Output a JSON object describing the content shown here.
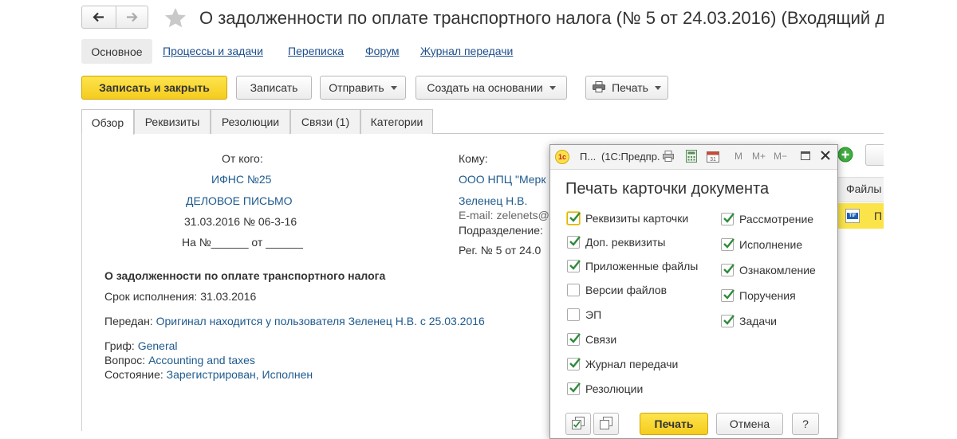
{
  "window": {
    "title": "О задолженности по оплате транспортного налога (№ 5 от 24.03.2016) (Входящий документ)"
  },
  "nav": {
    "main": "Основное",
    "links": [
      "Процессы и задачи",
      "Переписка",
      "Форум",
      "Журнал передачи"
    ]
  },
  "toolbar": {
    "save_close": "Записать и закрыть",
    "save": "Записать",
    "send": "Отправить",
    "create_based": "Создать на основании",
    "print": "Печать"
  },
  "tabs": [
    "Обзор",
    "Реквизиты",
    "Резолюции",
    "Связи (1)",
    "Категории"
  ],
  "doc": {
    "from_label": "От кого:",
    "from_org": "ИФНС №25",
    "doc_kind": "ДЕЛОВОЕ ПИСЬМО",
    "date_number": "31.03.2016 № 06-3-16",
    "ref_line": "На №______ от ______",
    "to_label": "Кому:",
    "to_org": "ООО НПЦ \"Мерк",
    "to_person": "Зеленец Н.В.",
    "email": "E-mail: zelenets@",
    "division_label": "Подразделение:",
    "reg": "Рег. № 5 от 24.0",
    "subject": "О задолженности по оплате транспортного налога",
    "deadline_label": "Срок исполнения:",
    "deadline_value": "31.03.2016",
    "handed_label": "Передан:",
    "handed_value": "Оригинал находится у пользователя Зеленец Н.В. с 25.03.2016",
    "grif_label": "Гриф:",
    "grif_value": "General",
    "question_label": "Вопрос:",
    "question_value": "Accounting and taxes",
    "state_label": "Состояние:",
    "state_value": "Зарегистрирован, Исполнен"
  },
  "right_panel": {
    "files_label": "Файлы",
    "file_item": "П"
  },
  "dialog": {
    "title_short": "П...",
    "title_app": "(1С:Предпр.",
    "toolbar_m": [
      "M",
      "M+",
      "M−"
    ],
    "heading": "Печать карточки документа",
    "left_items": [
      {
        "label": "Реквизиты карточки",
        "checked": true
      },
      {
        "label": "Доп. реквизиты",
        "checked": true
      },
      {
        "label": "Приложенные файлы",
        "checked": true
      },
      {
        "label": "Версии файлов",
        "checked": false
      },
      {
        "label": "ЭП",
        "checked": false
      },
      {
        "label": "Связи",
        "checked": true
      },
      {
        "label": "Журнал передачи",
        "checked": true
      },
      {
        "label": "Резолюции",
        "checked": true
      }
    ],
    "right_items": [
      {
        "label": "Рассмотрение",
        "checked": true
      },
      {
        "label": "Исполнение",
        "checked": true
      },
      {
        "label": "Ознакомление",
        "checked": true
      },
      {
        "label": "Поручения",
        "checked": true
      },
      {
        "label": "Задачи",
        "checked": true
      }
    ],
    "print_button": "Печать",
    "cancel_button": "Отмена",
    "help_button": "?"
  }
}
